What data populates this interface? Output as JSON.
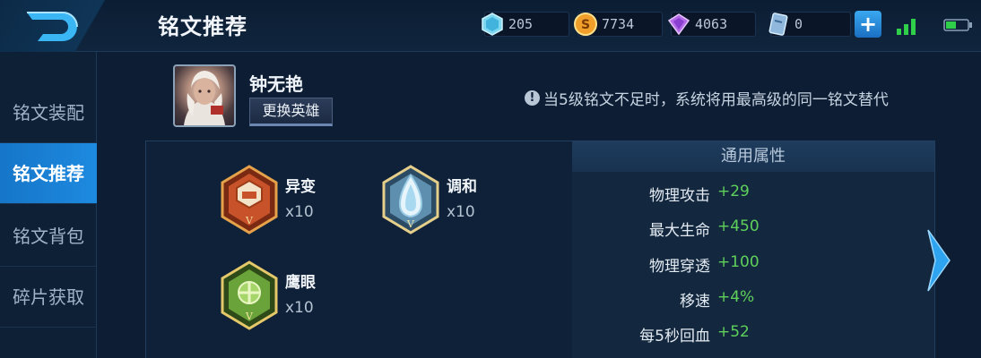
{
  "header": {
    "title": "铭文推荐",
    "currencies": [
      {
        "icon": "diamond-icon",
        "value": "205"
      },
      {
        "icon": "gold-coin-icon",
        "value": "7734"
      },
      {
        "icon": "purple-gem-icon",
        "value": "4063"
      },
      {
        "icon": "voucher-icon",
        "value": "0"
      }
    ],
    "plus_label": "+"
  },
  "sidebar": {
    "items": [
      {
        "label": "铭文装配",
        "active": false
      },
      {
        "label": "铭文推荐",
        "active": true
      },
      {
        "label": "铭文背包",
        "active": false
      },
      {
        "label": "碎片获取",
        "active": false
      }
    ]
  },
  "hero": {
    "name": "钟无艳",
    "change_label": "更换英雄"
  },
  "tip": {
    "icon": "info-icon",
    "text": "当5级铭文不足时，系统将用最高级的同一铭文替代"
  },
  "runes": [
    {
      "name": "异变",
      "count": "x10",
      "color": "#c8532a",
      "icon": "red-rune-icon"
    },
    {
      "name": "调和",
      "count": "x10",
      "color": "#6fa8c9",
      "icon": "blue-rune-icon"
    },
    {
      "name": "鹰眼",
      "count": "x10",
      "color": "#6aa33a",
      "icon": "green-rune-icon"
    }
  ],
  "attributes": {
    "header": "通用属性",
    "rows": [
      {
        "label": "物理攻击",
        "value": "+29"
      },
      {
        "label": "最大生命",
        "value": "+450"
      },
      {
        "label": "物理穿透",
        "value": "+100"
      },
      {
        "label": "移速",
        "value": "+4%"
      },
      {
        "label": "每5秒回血",
        "value": "+52"
      }
    ]
  },
  "colors": {
    "accent": "#1d8ae0",
    "positive": "#5fd05a",
    "background": "#0d1d33"
  }
}
